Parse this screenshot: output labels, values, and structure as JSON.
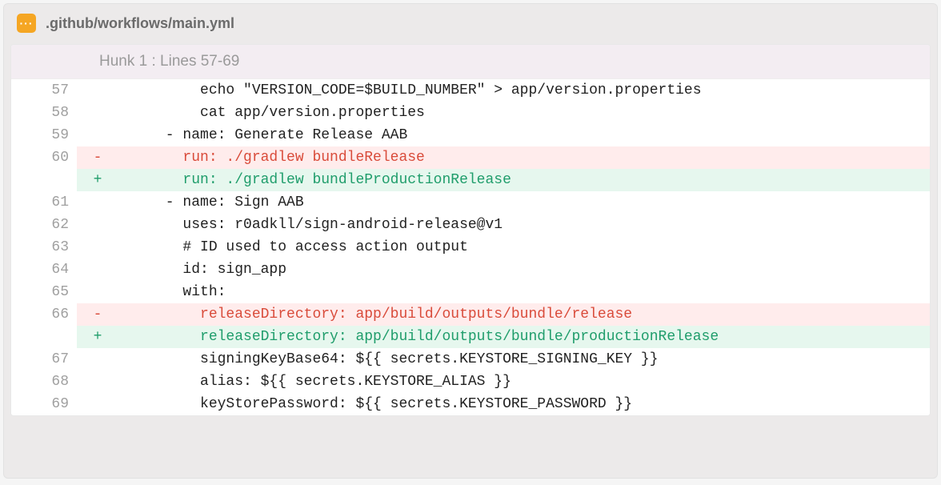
{
  "file": {
    "path": ".github/workflows/main.yml",
    "icon_glyph": "···"
  },
  "hunk": {
    "label": "Hunk 1 : Lines 57-69"
  },
  "lines": [
    {
      "num": "57",
      "type": "ctx",
      "marker": "",
      "text": "          echo \"VERSION_CODE=$BUILD_NUMBER\" > app/version.properties"
    },
    {
      "num": "58",
      "type": "ctx",
      "marker": "",
      "text": "          cat app/version.properties"
    },
    {
      "num": "59",
      "type": "ctx",
      "marker": "",
      "text": "      - name: Generate Release AAB"
    },
    {
      "num": "60",
      "type": "del",
      "marker": "-",
      "text": "        run: ./gradlew bundleRelease"
    },
    {
      "num": "",
      "type": "add",
      "marker": "+",
      "text": "        run: ./gradlew bundleProductionRelease"
    },
    {
      "num": "61",
      "type": "ctx",
      "marker": "",
      "text": "      - name: Sign AAB"
    },
    {
      "num": "62",
      "type": "ctx",
      "marker": "",
      "text": "        uses: r0adkll/sign-android-release@v1"
    },
    {
      "num": "63",
      "type": "ctx",
      "marker": "",
      "text": "        # ID used to access action output"
    },
    {
      "num": "64",
      "type": "ctx",
      "marker": "",
      "text": "        id: sign_app"
    },
    {
      "num": "65",
      "type": "ctx",
      "marker": "",
      "text": "        with:"
    },
    {
      "num": "66",
      "type": "del",
      "marker": "-",
      "text": "          releaseDirectory: app/build/outputs/bundle/release"
    },
    {
      "num": "",
      "type": "add",
      "marker": "+",
      "text": "          releaseDirectory: app/build/outputs/bundle/productionRelease"
    },
    {
      "num": "67",
      "type": "ctx",
      "marker": "",
      "text": "          signingKeyBase64: ${{ secrets.KEYSTORE_SIGNING_KEY }}"
    },
    {
      "num": "68",
      "type": "ctx",
      "marker": "",
      "text": "          alias: ${{ secrets.KEYSTORE_ALIAS }}"
    },
    {
      "num": "69",
      "type": "ctx",
      "marker": "",
      "text": "          keyStorePassword: ${{ secrets.KEYSTORE_PASSWORD }}"
    }
  ]
}
